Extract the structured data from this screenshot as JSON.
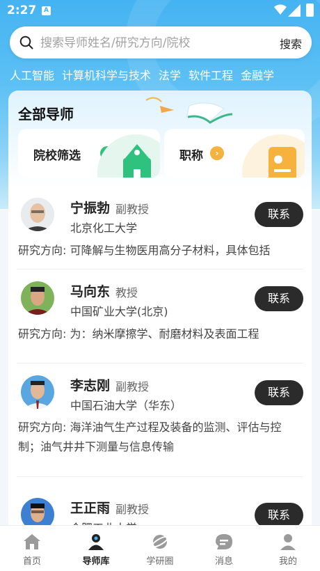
{
  "status_bar": {
    "time": "2:27",
    "indicator": "A"
  },
  "search": {
    "placeholder": "搜索导师姓名/研究方向/院校",
    "button": "搜索"
  },
  "categories": [
    "人工智能",
    "计算机科学与技术",
    "法学",
    "软件工程",
    "金融学"
  ],
  "panel": {
    "title": "全部导师",
    "filters": [
      {
        "label": "院校筛选",
        "arrow_color": "#2ec27e"
      },
      {
        "label": "职称",
        "arrow_color": "#f4b23f"
      }
    ]
  },
  "advisors": [
    {
      "name": "宁振勃",
      "rank": "副教授",
      "university": "北京化工大学",
      "research": "研究方向: 可降解与生物医用高分子材料，具体包括",
      "contact": "联系"
    },
    {
      "name": "马向东",
      "rank": "教授",
      "university": "中国矿业大学(北京)",
      "research": "研究方向: 为：纳米摩擦学、耐磨材料及表面工程",
      "contact": "联系"
    },
    {
      "name": "李志刚",
      "rank": "副教授",
      "university": "中国石油大学（华东）",
      "research": "研究方向: 海洋油气生产过程及装备的监测、评估与控制；油气井井下测量与信息传输",
      "contact": "联系"
    },
    {
      "name": "王正雨",
      "rank": "副教授",
      "university": "合肥工业大学",
      "research": "",
      "contact": "联系"
    }
  ],
  "tabbar": {
    "active": "导师库",
    "items": [
      "首页",
      "导师库",
      "学研圈",
      "消息",
      "我的"
    ]
  },
  "colors": {
    "accent_blue": "#45b3f2",
    "contact_button": "#2b2b2b"
  }
}
